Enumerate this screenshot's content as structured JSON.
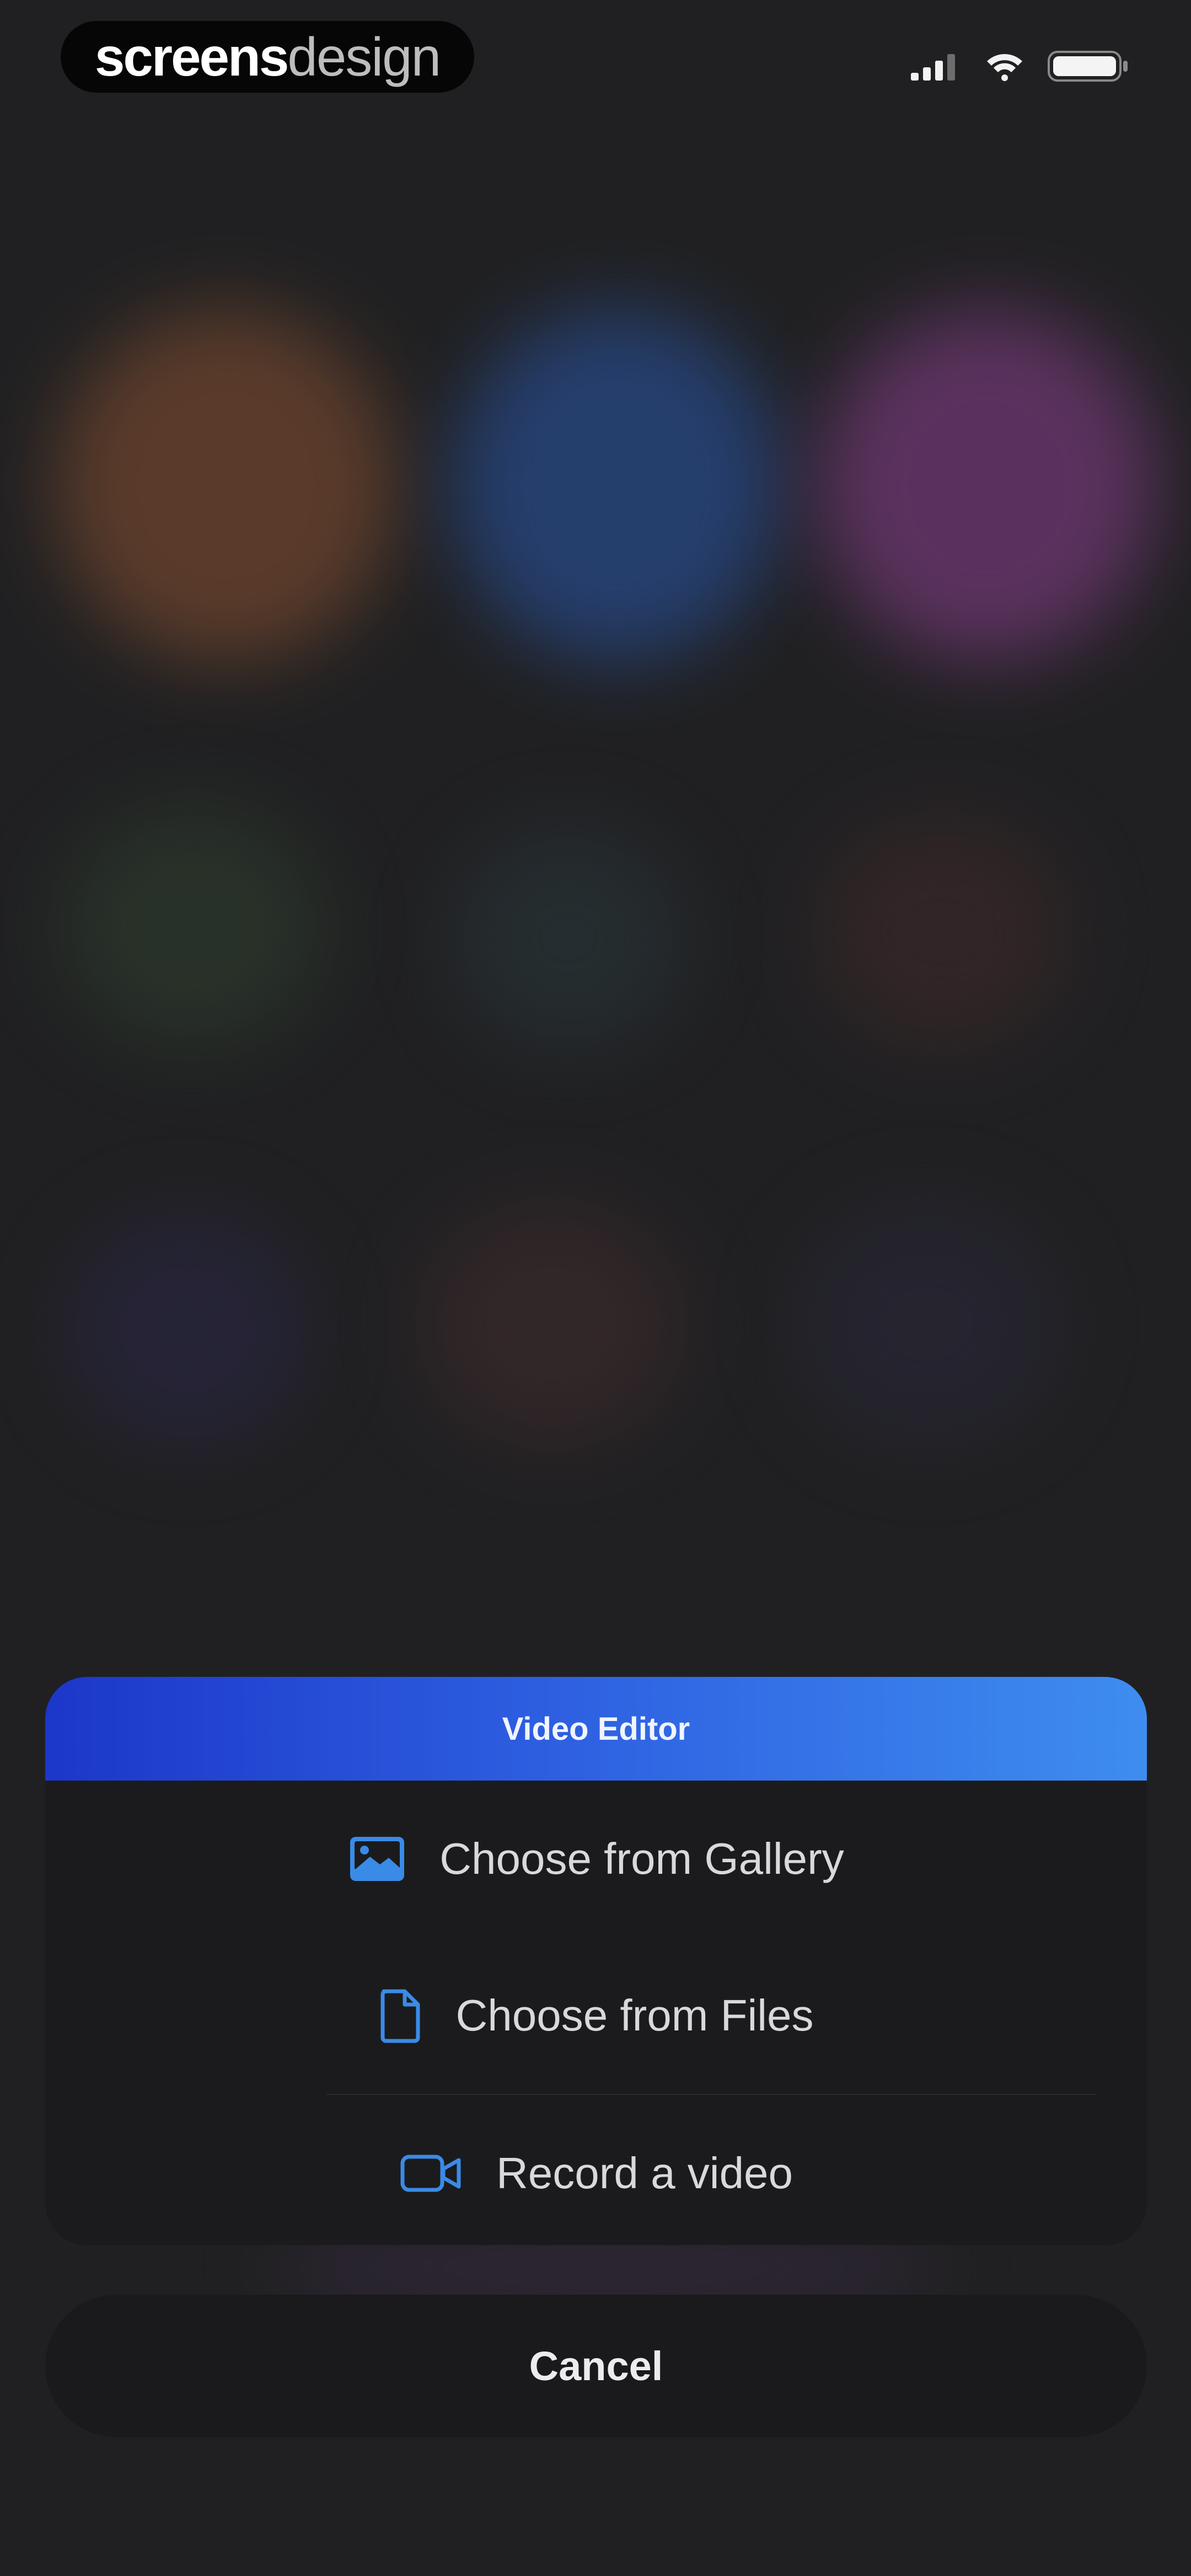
{
  "watermark": {
    "brand_bold": "screens",
    "brand_light": "design"
  },
  "status_bar": {
    "signal_icon": "cellular-signal-icon",
    "wifi_icon": "wifi-icon",
    "battery_icon": "battery-icon"
  },
  "background": {
    "state": "blurred",
    "tile_colors": [
      "#7a4a32",
      "#2f4d8a",
      "#7a3c7c",
      "#2f3a30",
      "#2c3438",
      "#3a2a2c",
      "#2c2840",
      "#3a2c30",
      "#2c2a38"
    ]
  },
  "sheet": {
    "title": "Video Editor",
    "accent_gradient": [
      "#1c37c9",
      "#3e8df0"
    ],
    "icon_color": "#3a8be6",
    "options": [
      {
        "label": "Choose from Gallery",
        "icon": "image-icon"
      },
      {
        "label": "Choose from Files",
        "icon": "file-icon"
      },
      {
        "label": "Record a video",
        "icon": "video-camera-icon"
      }
    ]
  },
  "cancel": {
    "label": "Cancel"
  }
}
